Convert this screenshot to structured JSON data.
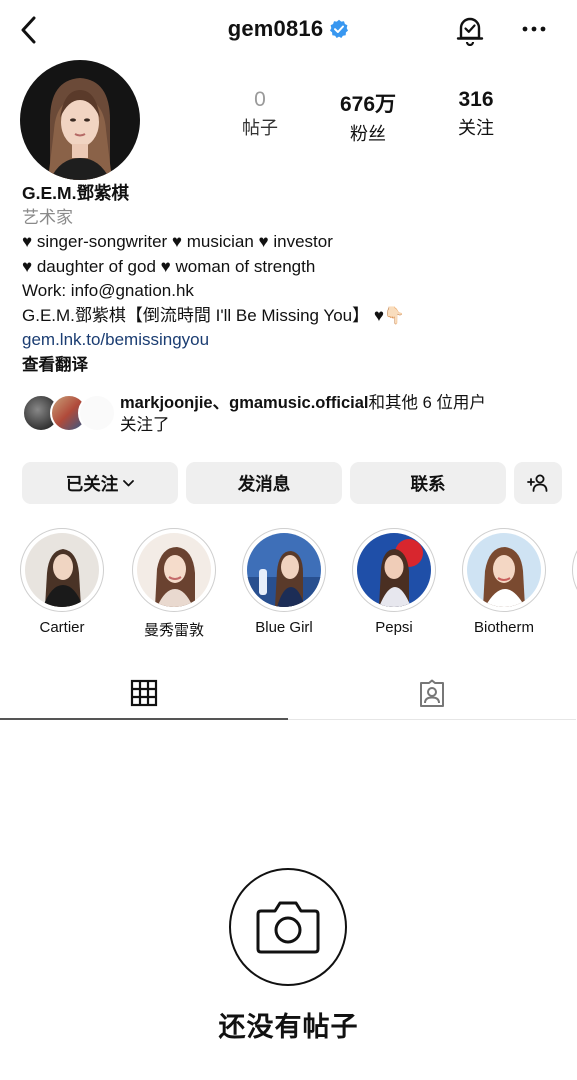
{
  "header": {
    "username": "gem0816",
    "icons": [
      "back-arrow-icon",
      "verified-badge-icon",
      "notification-bell-icon",
      "more-dots-icon"
    ]
  },
  "stats": {
    "posts": {
      "value": "0",
      "label": "帖子"
    },
    "followers": {
      "value": "676万",
      "label": "粉丝"
    },
    "following": {
      "value": "316",
      "label": "关注"
    }
  },
  "bio": {
    "name": "G.E.M.鄧紫棋",
    "category": "艺术家",
    "line1": [
      "♥ singer-songwriter ",
      "♥ musician ",
      "♥ investor"
    ],
    "line2": [
      "♥ daughter of god ",
      "♥ woman of strength"
    ],
    "line3": "Work: info@gnation.hk",
    "line4": "G.E.M.鄧紫棋【倒流時間 I'll Be Missing You】 ♥👇🏻",
    "link": "gem.lnk.to/bemissingyou",
    "translate": "查看翻译"
  },
  "followed_by": {
    "names": "markjoonjie、gmamusic.official",
    "suffix": "和其他 6 位用户",
    "line2": "关注了"
  },
  "buttons": {
    "following": "已关注",
    "message": "发消息",
    "contact": "联系",
    "icons": [
      "chevron-down-icon",
      "add-person-icon"
    ]
  },
  "highlights": [
    {
      "label": "Cartier"
    },
    {
      "label": "曼秀雷敦"
    },
    {
      "label": "Blue Girl"
    },
    {
      "label": "Pepsi"
    },
    {
      "label": "Biotherm"
    }
  ],
  "tabs": {
    "icons": [
      "grid-icon",
      "tagged-person-icon"
    ]
  },
  "empty_state": {
    "text": "还没有帖子",
    "icon": "camera-icon"
  },
  "colors": {
    "link": "#1b3d72",
    "verified": "#3897f0",
    "button_bg": "#efefef",
    "muted": "#8a8a8a"
  }
}
